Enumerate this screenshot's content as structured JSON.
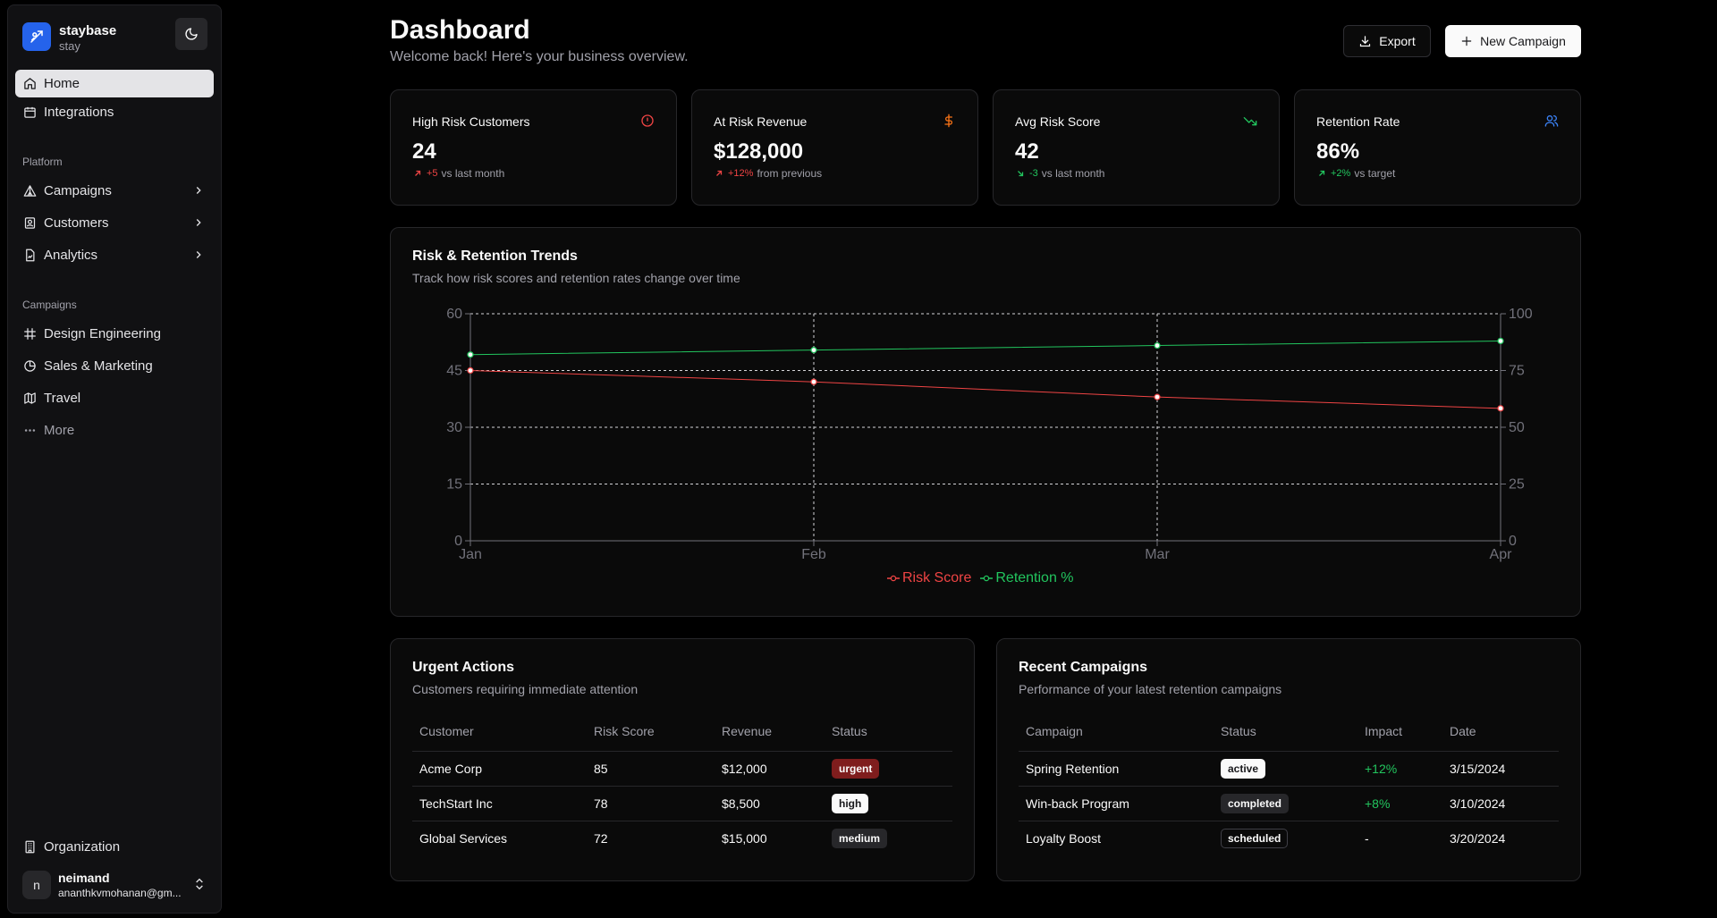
{
  "brand": {
    "name": "staybase",
    "sub": "stay"
  },
  "sidebar": {
    "nav": [
      {
        "label": "Home"
      },
      {
        "label": "Integrations"
      }
    ],
    "platform_label": "Platform",
    "platform": [
      {
        "label": "Campaigns"
      },
      {
        "label": "Customers"
      },
      {
        "label": "Analytics"
      }
    ],
    "campaigns_label": "Campaigns",
    "campaigns": [
      {
        "label": "Design Engineering"
      },
      {
        "label": "Sales & Marketing"
      },
      {
        "label": "Travel"
      },
      {
        "label": "More"
      }
    ],
    "organization": "Organization",
    "user": {
      "initial": "n",
      "name": "neimand",
      "email": "ananthkvmohanan@gm..."
    }
  },
  "header": {
    "title": "Dashboard",
    "subtitle": "Welcome back! Here's your business overview.",
    "export_label": "Export",
    "new_campaign_label": "New Campaign"
  },
  "stats": [
    {
      "title": "High Risk Customers",
      "value": "24",
      "delta": "+5",
      "note": "vs last month",
      "color": "#ef4444",
      "icon": "alert-circle-icon"
    },
    {
      "title": "At Risk Revenue",
      "value": "$128,000",
      "delta": "+12%",
      "note": "from previous",
      "color": "#f97316",
      "icon": "dollar-icon"
    },
    {
      "title": "Avg Risk Score",
      "value": "42",
      "delta": "-3",
      "note": "vs last month",
      "color": "#22c55e",
      "icon": "trending-down-icon"
    },
    {
      "title": "Retention Rate",
      "value": "86%",
      "delta": "+2%",
      "note": "vs target",
      "color": "#3b82f6",
      "icon": "users-icon"
    }
  ],
  "trends": {
    "title": "Risk & Retention Trends",
    "subtitle": "Track how risk scores and retention rates change over time"
  },
  "chart_data": {
    "type": "line",
    "categories": [
      "Jan",
      "Feb",
      "Mar",
      "Apr"
    ],
    "series": [
      {
        "name": "Risk Score",
        "axis": "left",
        "color": "#ef4444",
        "values": [
          45,
          42,
          38,
          35
        ]
      },
      {
        "name": "Retention %",
        "axis": "right",
        "color": "#22c55e",
        "values": [
          82,
          84,
          86,
          88
        ]
      }
    ],
    "y_left": {
      "ticks": [
        "0",
        "15",
        "30",
        "45",
        "60"
      ],
      "ylim": [
        0,
        60
      ]
    },
    "y_right": {
      "ticks": [
        "0",
        "25",
        "50",
        "75",
        "100"
      ],
      "ylim": [
        0,
        100
      ]
    },
    "grid": true,
    "legend": "bottom"
  },
  "urgent": {
    "title": "Urgent Actions",
    "subtitle": "Customers requiring immediate attention",
    "headers": [
      "Customer",
      "Risk Score",
      "Revenue",
      "Status"
    ],
    "rows": [
      {
        "customer": "Acme Corp",
        "risk": "85",
        "revenue": "$12,000",
        "status": "urgent"
      },
      {
        "customer": "TechStart Inc",
        "risk": "78",
        "revenue": "$8,500",
        "status": "high"
      },
      {
        "customer": "Global Services",
        "risk": "72",
        "revenue": "$15,000",
        "status": "medium"
      }
    ]
  },
  "recent": {
    "title": "Recent Campaigns",
    "subtitle": "Performance of your latest retention campaigns",
    "headers": [
      "Campaign",
      "Status",
      "Impact",
      "Date"
    ],
    "rows": [
      {
        "campaign": "Spring Retention",
        "status": "active",
        "impact": "+12%",
        "date": "3/15/2024"
      },
      {
        "campaign": "Win-back Program",
        "status": "completed",
        "impact": "+8%",
        "date": "3/10/2024"
      },
      {
        "campaign": "Loyalty Boost",
        "status": "scheduled",
        "impact": "-",
        "date": "3/20/2024"
      }
    ]
  }
}
